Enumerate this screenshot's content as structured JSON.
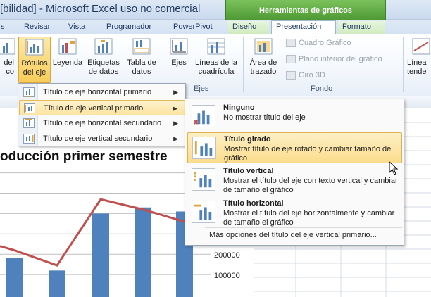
{
  "window": {
    "title": "[bilidad]  -  Microsoft Excel uso no comercial",
    "tool_context": "Herramientas de gráficos"
  },
  "tabs": [
    {
      "label": "s",
      "active": false
    },
    {
      "label": "Revisar",
      "active": false
    },
    {
      "label": "Vista",
      "active": false
    },
    {
      "label": "Programador",
      "active": false
    },
    {
      "label": "PowerPivot",
      "active": false
    },
    {
      "label": "Diseño",
      "active": false
    },
    {
      "label": "Presentación",
      "active": true
    },
    {
      "label": "Formato",
      "active": false
    }
  ],
  "ribbon": {
    "leyenda_partial": [
      "del",
      "co"
    ],
    "rotulos": [
      "Rótulos",
      "del eje"
    ],
    "leyenda": [
      "Leyenda",
      ""
    ],
    "etiquetas": [
      "Etiquetas",
      "de datos"
    ],
    "tabla": [
      "Tabla de",
      "datos"
    ],
    "ejes": [
      "Ejes",
      ""
    ],
    "lineas": [
      "Líneas de la",
      "cuadrícula"
    ],
    "area": [
      "Área de",
      "trazado"
    ],
    "ejes_group": "Ejes",
    "fondo_group": "Fondo",
    "cuadro": "Cuadro Gráfico",
    "plano": "Plano inferior del gráfico",
    "giro": "Giro 3D",
    "right_partial": [
      "Línea",
      "tende"
    ]
  },
  "menu1": {
    "items": [
      {
        "label": "Título de eje horizontal primario",
        "highlighted": false
      },
      {
        "label": "Título de eje vertical primario",
        "highlighted": true
      },
      {
        "label": "Título de eje horizontal secundario",
        "highlighted": false
      },
      {
        "label": "Título de eje vertical secundario",
        "highlighted": false
      }
    ]
  },
  "submenu": {
    "options": [
      {
        "heading": "Ninguno",
        "desc": "No mostrar título del eje",
        "highlighted": false
      },
      {
        "heading": "Título girado",
        "desc": "Mostrar título de eje rotado y cambiar tamaño del gráfico",
        "highlighted": true
      },
      {
        "heading": "Título vertical",
        "desc": "Mostrar el título del eje con texto vertical y cambiar de tamaño el gráfico",
        "highlighted": false
      },
      {
        "heading": "Título horizontal",
        "desc": "Mostrar el título del eje horizontalmente y cambiar de tamaño el gráfico",
        "highlighted": false
      }
    ],
    "more": "Más opciones del título del eje vertical primario..."
  },
  "chart": {
    "title": "oducción primer semestre"
  },
  "chart_data": {
    "type": "bar",
    "title": "oducción primer semestre",
    "series": [
      {
        "type": "bar",
        "values": [
          180000,
          120000,
          400000,
          430000,
          410000
        ]
      },
      {
        "type": "line",
        "values": [
          220000,
          145000,
          470000,
          420000,
          360000
        ]
      }
    ],
    "y_ticks": [
      "200000",
      "100000"
    ],
    "grid": true,
    "colors": {
      "bar": "#4f81bd",
      "line": "#c0504d"
    }
  }
}
